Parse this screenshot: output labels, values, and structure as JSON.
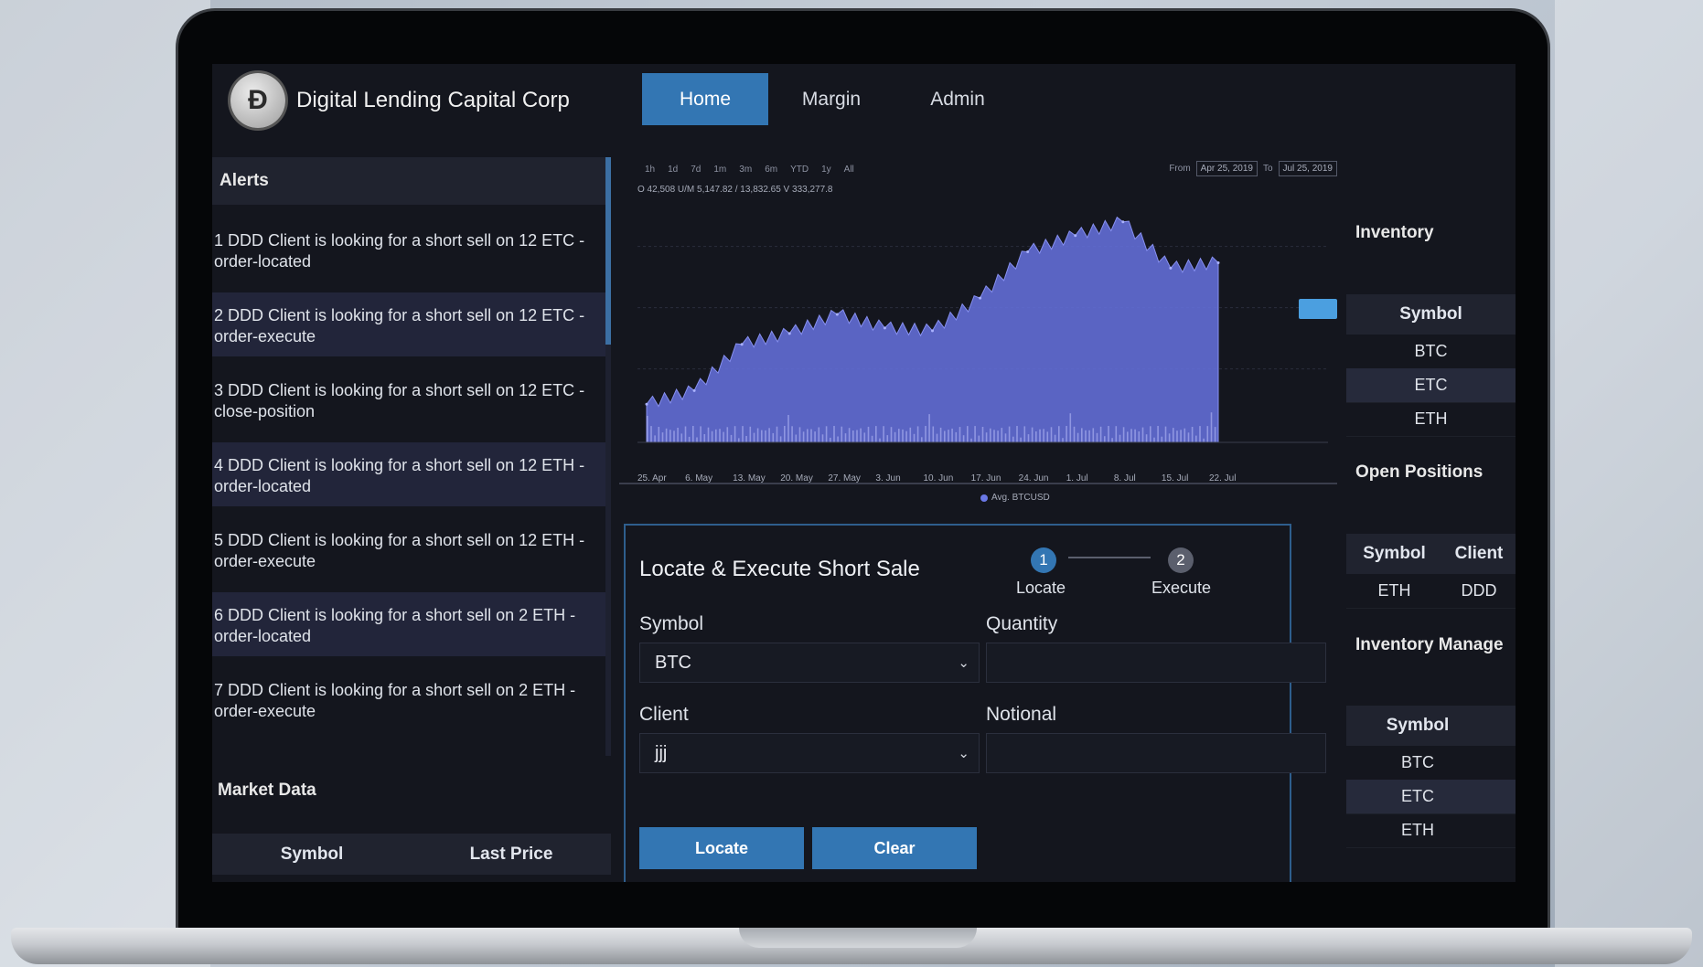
{
  "app": {
    "brand_initial": "Đ",
    "brand_name": "Digital Lending Capital Corp"
  },
  "nav": [
    {
      "label": "Home",
      "active": true
    },
    {
      "label": "Margin",
      "active": false
    },
    {
      "label": "Admin",
      "active": false
    }
  ],
  "alerts": {
    "title": "Alerts",
    "items": [
      {
        "label": "1 DDD Client is looking for a short sell on 12 ETC - order-located"
      },
      {
        "label": "2 DDD Client is looking for a short sell on 12 ETC - order-execute"
      },
      {
        "label": "3 DDD Client is looking for a short sell on 12 ETC - close-position"
      },
      {
        "label": "4 DDD Client is looking for a short sell on 12 ETH - order-located"
      },
      {
        "label": "5 DDD Client is looking for a short sell on 12 ETH - order-execute"
      },
      {
        "label": "6 DDD Client is looking for a short sell on 2 ETH - order-located"
      },
      {
        "label": "7 DDD Client is looking for a short sell on 2 ETH - order-execute"
      }
    ]
  },
  "market_data": {
    "title": "Market Data",
    "columns": [
      "Symbol",
      "Last Price"
    ]
  },
  "chart": {
    "range_buttons": [
      "1h",
      "1d",
      "7d",
      "1m",
      "3m",
      "6m",
      "YTD",
      "1y",
      "All"
    ],
    "from_label": "From",
    "from_date": "Apr 25, 2019",
    "to_label": "To",
    "to_date": "Jul 25, 2019",
    "ohlc": "O 42,508 U/M 5,147.82 / 13,832.65 V 333,277.8",
    "legend": "Avg. BTCUSD"
  },
  "chart_data": {
    "type": "area",
    "x": [
      "25. Apr",
      "6. May",
      "13. May",
      "20. May",
      "27. May",
      "3. Jun",
      "10. Jun",
      "17. Jun",
      "24. Jun",
      "1. Jul",
      "8. Jul",
      "15. Jul",
      "22. Jul"
    ],
    "series": [
      {
        "name": "Avg. BTCUSD",
        "values": [
          5400,
          5900,
          7600,
          8000,
          8700,
          8200,
          8100,
          9300,
          11000,
          11600,
          12100,
          10400,
          10600
        ],
        "color": "#6672e0"
      }
    ],
    "tick_labels": [
      "25. Apr",
      "6. May",
      "13. May",
      "20. May",
      "27. May",
      "3. Jun",
      "10. Jun",
      "17. Jun",
      "24. Jun",
      "1. Jul",
      "8. Jul",
      "15. Jul",
      "22. Jul"
    ],
    "grid": true
  },
  "form": {
    "title": "Locate & Execute Short Sale",
    "steps": [
      {
        "number": "1",
        "label": "Locate",
        "active": true
      },
      {
        "number": "2",
        "label": "Execute",
        "active": false
      }
    ],
    "symbol_label": "Symbol",
    "symbol_value": "BTC",
    "quantity_label": "Quantity",
    "quantity_value": "",
    "client_label": "Client",
    "client_value": "jjj",
    "notional_label": "Notional",
    "notional_value": "",
    "locate_button": "Locate",
    "clear_button": "Clear"
  },
  "inventory": {
    "title": "Inventory",
    "column": "Symbol",
    "rows": [
      "BTC",
      "ETC",
      "ETH"
    ]
  },
  "open_positions": {
    "title": "Open Positions",
    "columns": [
      "Symbol",
      "Client"
    ],
    "rows": [
      {
        "symbol": "ETH",
        "client": "DDD"
      }
    ]
  },
  "inventory_manage": {
    "title": "Inventory Manage",
    "column": "Symbol",
    "rows": [
      "BTC",
      "ETC",
      "ETH"
    ]
  },
  "colors": {
    "accent": "#3376b3",
    "panel_bg": "#14161e",
    "row_alt": "#22253a",
    "series": "#6672e0"
  }
}
